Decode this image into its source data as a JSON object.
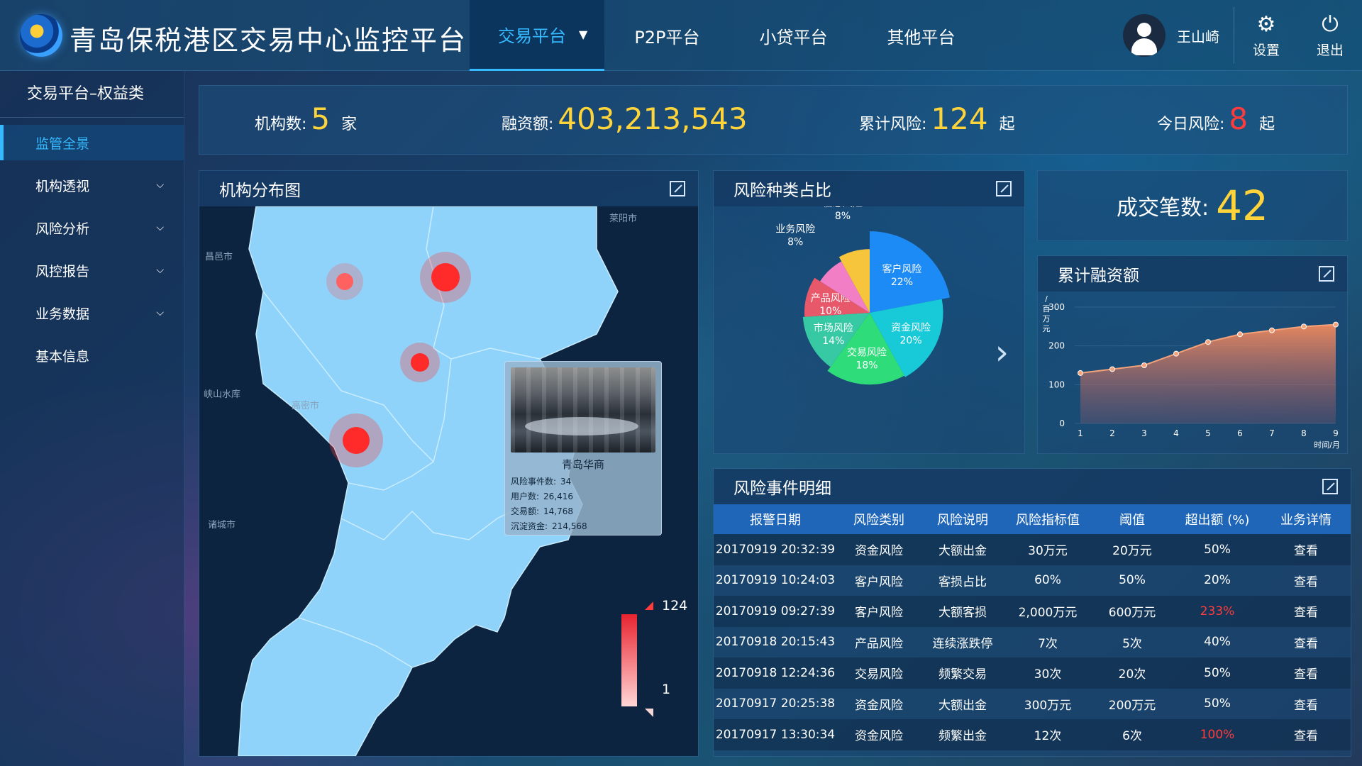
{
  "header": {
    "title": "青岛保税港区交易中心监控平台",
    "nav": [
      {
        "label": "交易平台",
        "active": true
      },
      {
        "label": "P2P平台"
      },
      {
        "label": "小贷平台"
      },
      {
        "label": "其他平台"
      }
    ],
    "user": "王山崎",
    "settings_label": "设置",
    "logout_label": "退出",
    "icons": {
      "settings": "gear-icon",
      "logout": "power-icon",
      "user": "user-icon"
    }
  },
  "sidebar": {
    "title": "交易平台–权益类",
    "items": [
      {
        "label": "监管全景",
        "active": true
      },
      {
        "label": "机构透视",
        "expandable": true
      },
      {
        "label": "风险分析",
        "expandable": true
      },
      {
        "label": "风控报告",
        "expandable": true
      },
      {
        "label": "业务数据",
        "expandable": true
      },
      {
        "label": "基本信息"
      }
    ]
  },
  "stats": {
    "org": {
      "label": "机构数:",
      "value": "5",
      "unit": "家"
    },
    "finance": {
      "label": "融资额:",
      "value": "403,213,543"
    },
    "cum_risk": {
      "label": "累计风险:",
      "value": "124",
      "unit": "起"
    },
    "today_risk": {
      "label": "今日风险:",
      "value": "8",
      "unit": "起"
    }
  },
  "map": {
    "title": "机构分布图",
    "cities": [
      "莱阳市",
      "昌邑市",
      "峡山水库",
      "高密市",
      "诸城市"
    ],
    "tooltip": {
      "name": "青岛华商",
      "rows": [
        {
          "label": "风险事件数:",
          "value": "34"
        },
        {
          "label": "用户数:",
          "value": "26,416"
        },
        {
          "label": "交易额:",
          "value": "14,768"
        },
        {
          "label": "沉淀资金:",
          "value": "214,568"
        }
      ]
    },
    "legend_max": "124",
    "legend_min": "1",
    "colors": {
      "land": "#8fd3fb",
      "sea": "#0d2440",
      "hotspot": "#ff2a2a"
    }
  },
  "pie": {
    "title": "风险种类占比",
    "chart_data": {
      "type": "pie",
      "slices": [
        {
          "name": "客户风险",
          "value": 22,
          "color": "#1d8bf5"
        },
        {
          "name": "资金风险",
          "value": 20,
          "color": "#18c9d8"
        },
        {
          "name": "交易风险",
          "value": 18,
          "color": "#2fdc7a"
        },
        {
          "name": "市场风险",
          "value": 14,
          "color": "#37c9a4"
        },
        {
          "name": "产品风险",
          "value": 10,
          "color": "#e8586b"
        },
        {
          "name": "业务风险",
          "value": 8,
          "color": "#f27fc5"
        },
        {
          "name": "信息风险",
          "value": 8,
          "color": "#f7c53c"
        }
      ]
    }
  },
  "deals": {
    "label": "成交笔数:",
    "value": "42"
  },
  "line": {
    "title": "累计融资额",
    "chart_data": {
      "type": "area",
      "x": [
        1,
        2,
        3,
        4,
        5,
        6,
        7,
        8,
        9
      ],
      "values": [
        130,
        140,
        150,
        180,
        210,
        230,
        240,
        250,
        255
      ],
      "ylabel": "/百万元",
      "xlabel": "时间/月",
      "y_ticks": [
        0,
        100,
        200,
        300
      ],
      "ylim": [
        0,
        300
      ]
    }
  },
  "table": {
    "title": "风险事件明细",
    "columns": [
      "报警日期",
      "风险类别",
      "风险说明",
      "风险指标值",
      "阈值",
      "超出额 (%)",
      "业务详情"
    ],
    "rows": [
      [
        "20170919  20:32:39",
        "资金风险",
        "大额出金",
        "30万元",
        "20万元",
        "50%",
        "查看"
      ],
      [
        "20170919  10:24:03",
        "客户风险",
        "客损占比",
        "60%",
        "50%",
        "20%",
        "查看"
      ],
      [
        "20170919  09:27:39",
        "客户风险",
        "大额客损",
        "2,000万元",
        "600万元",
        "233%",
        "查看"
      ],
      [
        "20170918  20:15:43",
        "产品风险",
        "连续涨跌停",
        "7次",
        "5次",
        "40%",
        "查看"
      ],
      [
        "20170918  12:24:36",
        "交易风险",
        "频繁交易",
        "30次",
        "20次",
        "50%",
        "查看"
      ],
      [
        "20170917  20:25:38",
        "资金风险",
        "大额出金",
        "300万元",
        "200万元",
        "50%",
        "查看"
      ],
      [
        "20170917  13:30:34",
        "资金风险",
        "频繁出金",
        "12次",
        "6次",
        "100%",
        "查看"
      ]
    ],
    "highlight_rows": [
      2,
      6
    ]
  }
}
